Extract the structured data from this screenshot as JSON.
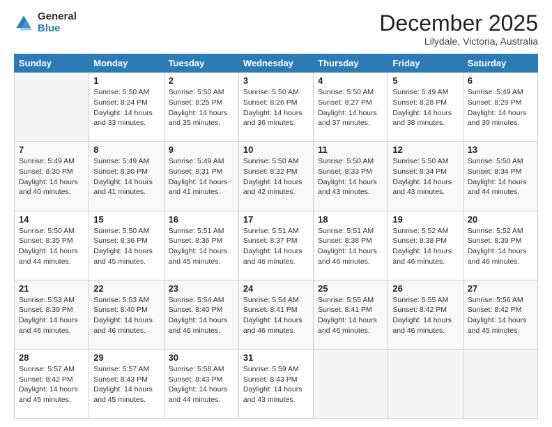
{
  "logo": {
    "general": "General",
    "blue": "Blue"
  },
  "header": {
    "month": "December 2025",
    "location": "Lilydale, Victoria, Australia"
  },
  "days": [
    "Sunday",
    "Monday",
    "Tuesday",
    "Wednesday",
    "Thursday",
    "Friday",
    "Saturday"
  ],
  "weeks": [
    [
      {
        "day": "",
        "sunrise": "",
        "sunset": "",
        "daylight": ""
      },
      {
        "day": "1",
        "sunrise": "Sunrise: 5:50 AM",
        "sunset": "Sunset: 8:24 PM",
        "daylight": "Daylight: 14 hours and 33 minutes."
      },
      {
        "day": "2",
        "sunrise": "Sunrise: 5:50 AM",
        "sunset": "Sunset: 8:25 PM",
        "daylight": "Daylight: 14 hours and 35 minutes."
      },
      {
        "day": "3",
        "sunrise": "Sunrise: 5:50 AM",
        "sunset": "Sunset: 8:26 PM",
        "daylight": "Daylight: 14 hours and 36 minutes."
      },
      {
        "day": "4",
        "sunrise": "Sunrise: 5:50 AM",
        "sunset": "Sunset: 8:27 PM",
        "daylight": "Daylight: 14 hours and 37 minutes."
      },
      {
        "day": "5",
        "sunrise": "Sunrise: 5:49 AM",
        "sunset": "Sunset: 8:28 PM",
        "daylight": "Daylight: 14 hours and 38 minutes."
      },
      {
        "day": "6",
        "sunrise": "Sunrise: 5:49 AM",
        "sunset": "Sunset: 8:29 PM",
        "daylight": "Daylight: 14 hours and 39 minutes."
      }
    ],
    [
      {
        "day": "7",
        "sunrise": "Sunrise: 5:49 AM",
        "sunset": "Sunset: 8:30 PM",
        "daylight": "Daylight: 14 hours and 40 minutes."
      },
      {
        "day": "8",
        "sunrise": "Sunrise: 5:49 AM",
        "sunset": "Sunset: 8:30 PM",
        "daylight": "Daylight: 14 hours and 41 minutes."
      },
      {
        "day": "9",
        "sunrise": "Sunrise: 5:49 AM",
        "sunset": "Sunset: 8:31 PM",
        "daylight": "Daylight: 14 hours and 41 minutes."
      },
      {
        "day": "10",
        "sunrise": "Sunrise: 5:50 AM",
        "sunset": "Sunset: 8:32 PM",
        "daylight": "Daylight: 14 hours and 42 minutes."
      },
      {
        "day": "11",
        "sunrise": "Sunrise: 5:50 AM",
        "sunset": "Sunset: 8:33 PM",
        "daylight": "Daylight: 14 hours and 43 minutes."
      },
      {
        "day": "12",
        "sunrise": "Sunrise: 5:50 AM",
        "sunset": "Sunset: 8:34 PM",
        "daylight": "Daylight: 14 hours and 43 minutes."
      },
      {
        "day": "13",
        "sunrise": "Sunrise: 5:50 AM",
        "sunset": "Sunset: 8:34 PM",
        "daylight": "Daylight: 14 hours and 44 minutes."
      }
    ],
    [
      {
        "day": "14",
        "sunrise": "Sunrise: 5:50 AM",
        "sunset": "Sunset: 8:35 PM",
        "daylight": "Daylight: 14 hours and 44 minutes."
      },
      {
        "day": "15",
        "sunrise": "Sunrise: 5:50 AM",
        "sunset": "Sunset: 8:36 PM",
        "daylight": "Daylight: 14 hours and 45 minutes."
      },
      {
        "day": "16",
        "sunrise": "Sunrise: 5:51 AM",
        "sunset": "Sunset: 8:36 PM",
        "daylight": "Daylight: 14 hours and 45 minutes."
      },
      {
        "day": "17",
        "sunrise": "Sunrise: 5:51 AM",
        "sunset": "Sunset: 8:37 PM",
        "daylight": "Daylight: 14 hours and 46 minutes."
      },
      {
        "day": "18",
        "sunrise": "Sunrise: 5:51 AM",
        "sunset": "Sunset: 8:38 PM",
        "daylight": "Daylight: 14 hours and 46 minutes."
      },
      {
        "day": "19",
        "sunrise": "Sunrise: 5:52 AM",
        "sunset": "Sunset: 8:38 PM",
        "daylight": "Daylight: 14 hours and 46 minutes."
      },
      {
        "day": "20",
        "sunrise": "Sunrise: 5:52 AM",
        "sunset": "Sunset: 8:39 PM",
        "daylight": "Daylight: 14 hours and 46 minutes."
      }
    ],
    [
      {
        "day": "21",
        "sunrise": "Sunrise: 5:53 AM",
        "sunset": "Sunset: 8:39 PM",
        "daylight": "Daylight: 14 hours and 46 minutes."
      },
      {
        "day": "22",
        "sunrise": "Sunrise: 5:53 AM",
        "sunset": "Sunset: 8:40 PM",
        "daylight": "Daylight: 14 hours and 46 minutes."
      },
      {
        "day": "23",
        "sunrise": "Sunrise: 5:54 AM",
        "sunset": "Sunset: 8:40 PM",
        "daylight": "Daylight: 14 hours and 46 minutes."
      },
      {
        "day": "24",
        "sunrise": "Sunrise: 5:54 AM",
        "sunset": "Sunset: 8:41 PM",
        "daylight": "Daylight: 14 hours and 46 minutes."
      },
      {
        "day": "25",
        "sunrise": "Sunrise: 5:55 AM",
        "sunset": "Sunset: 8:41 PM",
        "daylight": "Daylight: 14 hours and 46 minutes."
      },
      {
        "day": "26",
        "sunrise": "Sunrise: 5:55 AM",
        "sunset": "Sunset: 8:42 PM",
        "daylight": "Daylight: 14 hours and 46 minutes."
      },
      {
        "day": "27",
        "sunrise": "Sunrise: 5:56 AM",
        "sunset": "Sunset: 8:42 PM",
        "daylight": "Daylight: 14 hours and 45 minutes."
      }
    ],
    [
      {
        "day": "28",
        "sunrise": "Sunrise: 5:57 AM",
        "sunset": "Sunset: 8:42 PM",
        "daylight": "Daylight: 14 hours and 45 minutes."
      },
      {
        "day": "29",
        "sunrise": "Sunrise: 5:57 AM",
        "sunset": "Sunset: 8:43 PM",
        "daylight": "Daylight: 14 hours and 45 minutes."
      },
      {
        "day": "30",
        "sunrise": "Sunrise: 5:58 AM",
        "sunset": "Sunset: 8:43 PM",
        "daylight": "Daylight: 14 hours and 44 minutes."
      },
      {
        "day": "31",
        "sunrise": "Sunrise: 5:59 AM",
        "sunset": "Sunset: 8:43 PM",
        "daylight": "Daylight: 14 hours and 43 minutes."
      },
      {
        "day": "",
        "sunrise": "",
        "sunset": "",
        "daylight": ""
      },
      {
        "day": "",
        "sunrise": "",
        "sunset": "",
        "daylight": ""
      },
      {
        "day": "",
        "sunrise": "",
        "sunset": "",
        "daylight": ""
      }
    ]
  ]
}
